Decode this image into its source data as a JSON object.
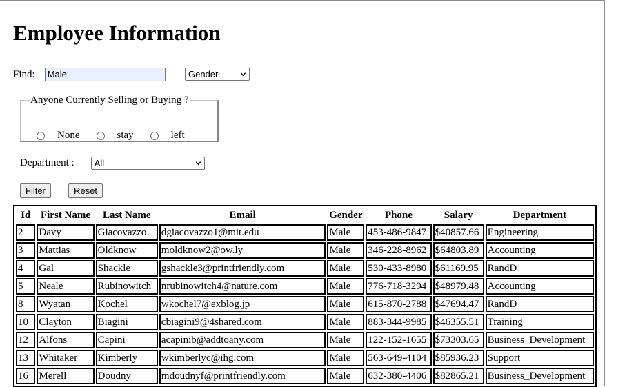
{
  "page": {
    "title": "Employee Information"
  },
  "filters": {
    "find_label": "Find:",
    "find_value": "Male",
    "field_select": "Gender",
    "selling_legend": "Anyone Currently Selling or Buying ?",
    "radio_options": [
      "None",
      "stay",
      "left"
    ],
    "department_label": "Department :",
    "department_select": "All",
    "filter_button": "Filter",
    "reset_button": "Reset"
  },
  "table": {
    "headers": [
      "Id",
      "First Name",
      "Last Name",
      "Email",
      "Gender",
      "Phone",
      "Salary",
      "Department"
    ],
    "rows": [
      [
        "2",
        "Davy",
        "Giacovazzo",
        "dgiacovazzo1@mit.edu",
        "Male",
        "453-486-9847",
        "$40857.66",
        "Engineering"
      ],
      [
        "3",
        "Mattias",
        "Oldknow",
        "moldknow2@ow.ly",
        "Male",
        "346-228-8962",
        "$64803.89",
        "Accounting"
      ],
      [
        "4",
        "Gal",
        "Shackle",
        "gshackle3@printfriendly.com",
        "Male",
        "530-433-8980",
        "$61169.95",
        "RandD"
      ],
      [
        "5",
        "Neale",
        "Rubinowitch",
        "nrubinowitch4@nature.com",
        "Male",
        "776-718-3294",
        "$48979.48",
        "Accounting"
      ],
      [
        "8",
        "Wyatan",
        "Kochel",
        "wkochel7@exblog.jp",
        "Male",
        "615-870-2788",
        "$47694.47",
        "RandD"
      ],
      [
        "10",
        "Clayton",
        "Biagini",
        "cbiagini9@4shared.com",
        "Male",
        "883-344-9985",
        "$46355.51",
        "Training"
      ],
      [
        "12",
        "Alfons",
        "Capini",
        "acapinib@addtoany.com",
        "Male",
        "122-152-1655",
        "$73303.65",
        "Business_Development"
      ],
      [
        "13",
        "Whitaker",
        "Kimberly",
        "wkimberlyc@ihg.com",
        "Male",
        "563-649-4104",
        "$85936.23",
        "Support"
      ],
      [
        "16",
        "Merell",
        "Doudny",
        "mdoudnyf@printfriendly.com",
        "Male",
        "632-380-4406",
        "$82865.21",
        "Business_Development"
      ]
    ]
  },
  "icons": {
    "select_arrow": "chevron-down-icon"
  }
}
